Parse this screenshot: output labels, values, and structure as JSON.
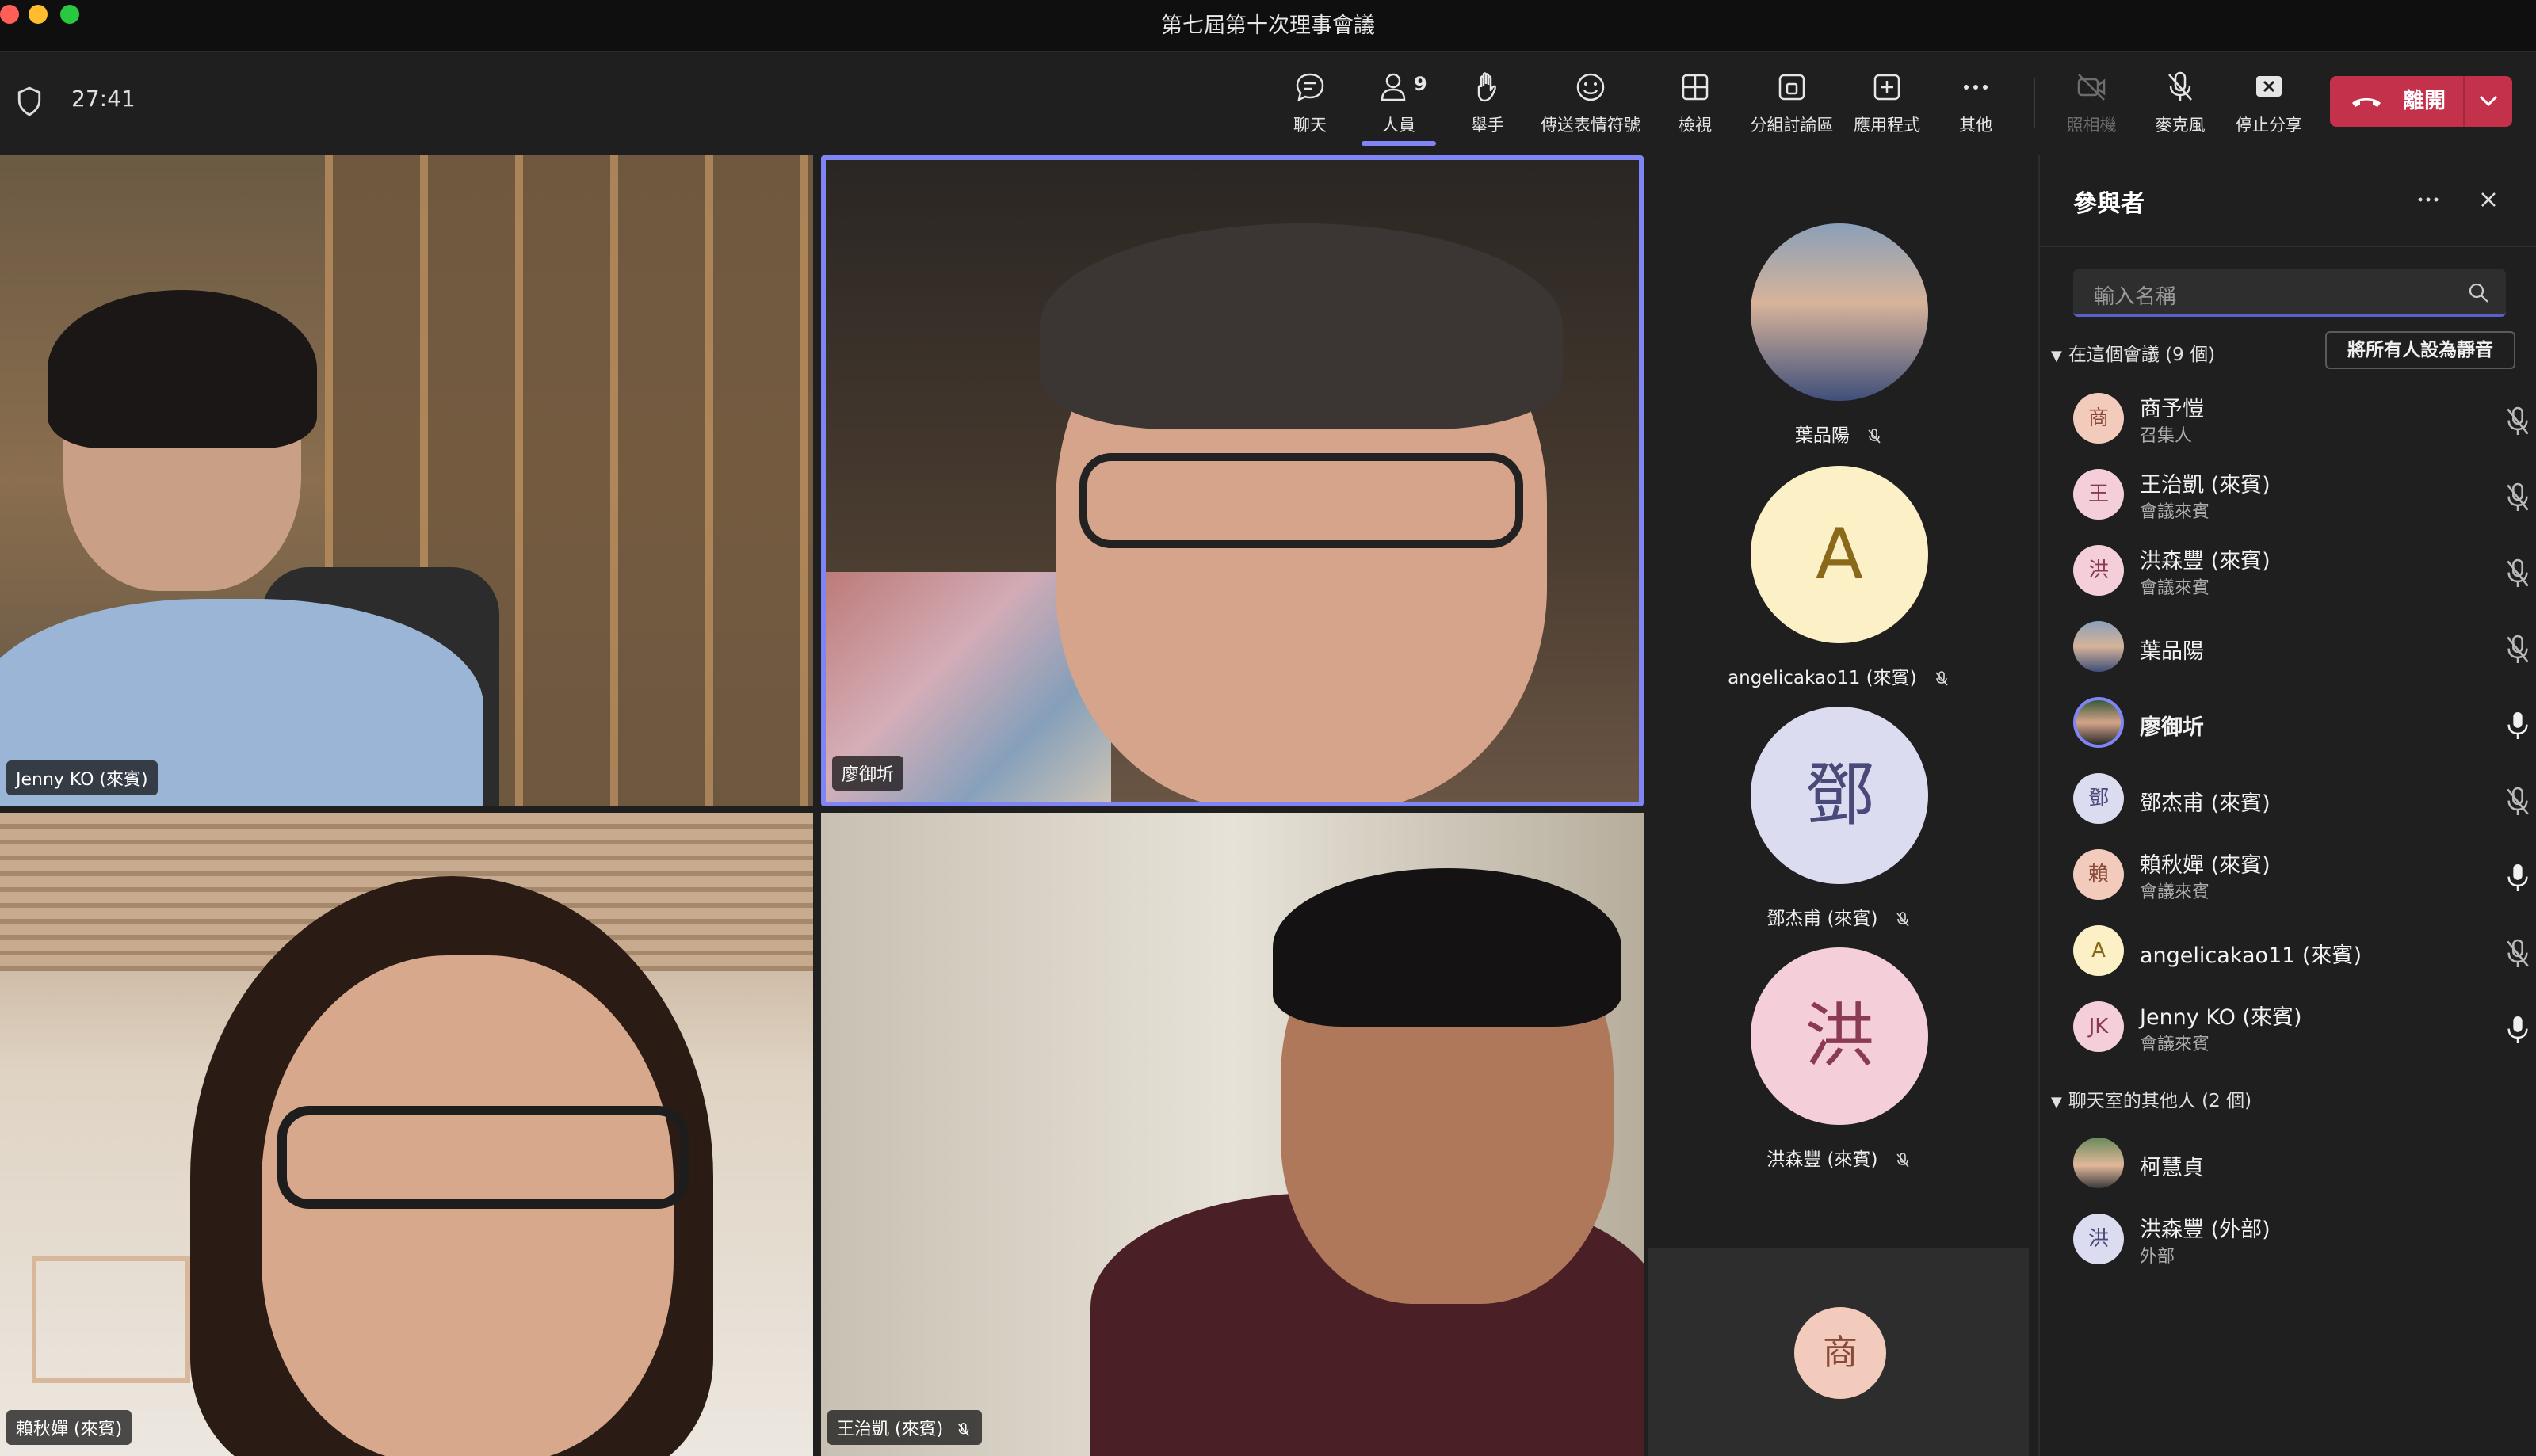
{
  "window": {
    "title": "第七屆第十次理事會議"
  },
  "toolbar": {
    "timer": "27:41",
    "people_count": "9",
    "buttons": [
      {
        "label": "聊天",
        "icon": "chat-icon"
      },
      {
        "label": "人員",
        "icon": "people-icon"
      },
      {
        "label": "舉手",
        "icon": "raise-hand-icon"
      },
      {
        "label": "傳送表情符號",
        "icon": "emoji-icon"
      },
      {
        "label": "檢視",
        "icon": "view-icon"
      },
      {
        "label": "分組討論區",
        "icon": "breakout-icon"
      },
      {
        "label": "應用程式",
        "icon": "apps-icon"
      },
      {
        "label": "其他",
        "icon": "more-icon"
      },
      {
        "label": "照相機",
        "icon": "camera-off-icon"
      },
      {
        "label": "麥克風",
        "icon": "mic-off-icon"
      },
      {
        "label": "停止分享",
        "icon": "stop-share-icon"
      }
    ],
    "leave_label": "離開"
  },
  "video_tiles": [
    {
      "name": "Jenny KO (來賓)"
    },
    {
      "name": "廖御圻"
    },
    {
      "name": "賴秋嬋 (來賓)"
    },
    {
      "name": "王治凱 (來賓)"
    }
  ],
  "people_column": [
    {
      "name": "葉品陽",
      "initial": ""
    },
    {
      "name": "angelicakao11 (來賓)",
      "initial": "A"
    },
    {
      "name": "鄧杰甫 (來賓)",
      "initial": "鄧"
    },
    {
      "name": "洪森豐 (來賓)",
      "initial": "洪"
    }
  ],
  "mini_tile": {
    "initial": "商"
  },
  "panel": {
    "title": "參與者",
    "search_placeholder": "輸入名稱",
    "in_meeting_label": "在這個會議 (9 個)",
    "mute_all_label": "將所有人設為靜音",
    "participants": [
      {
        "initial": "商",
        "name": "商予愷",
        "sub": "召集人",
        "mic": "off"
      },
      {
        "initial": "王",
        "name": "王治凱 (來賓)",
        "sub": "會議來賓",
        "mic": "off"
      },
      {
        "initial": "洪",
        "name": "洪森豐 (來賓)",
        "sub": "會議來賓",
        "mic": "off"
      },
      {
        "initial": "",
        "name": "葉品陽",
        "sub": "",
        "mic": "off"
      },
      {
        "initial": "",
        "name": "廖御圻",
        "sub": "",
        "mic": "on"
      },
      {
        "initial": "鄧",
        "name": "鄧杰甫 (來賓)",
        "sub": "",
        "mic": "off"
      },
      {
        "initial": "賴",
        "name": "賴秋嬋 (來賓)",
        "sub": "會議來賓",
        "mic": "on"
      },
      {
        "initial": "A",
        "name": "angelicakao11 (來賓)",
        "sub": "",
        "mic": "off"
      },
      {
        "initial": "JK",
        "name": "Jenny KO (來賓)",
        "sub": "會議來賓",
        "mic": "on"
      }
    ],
    "chat_others_label": "聊天室的其他人 (2 個)",
    "chat_others": [
      {
        "initial": "",
        "name": "柯慧貞",
        "sub": ""
      },
      {
        "initial": "洪",
        "name": "洪森豐 (外部)",
        "sub": "外部"
      }
    ]
  },
  "colors": {
    "accent": "#7f85f5",
    "leave": "#c4314b",
    "background": "#1f1f1f"
  }
}
